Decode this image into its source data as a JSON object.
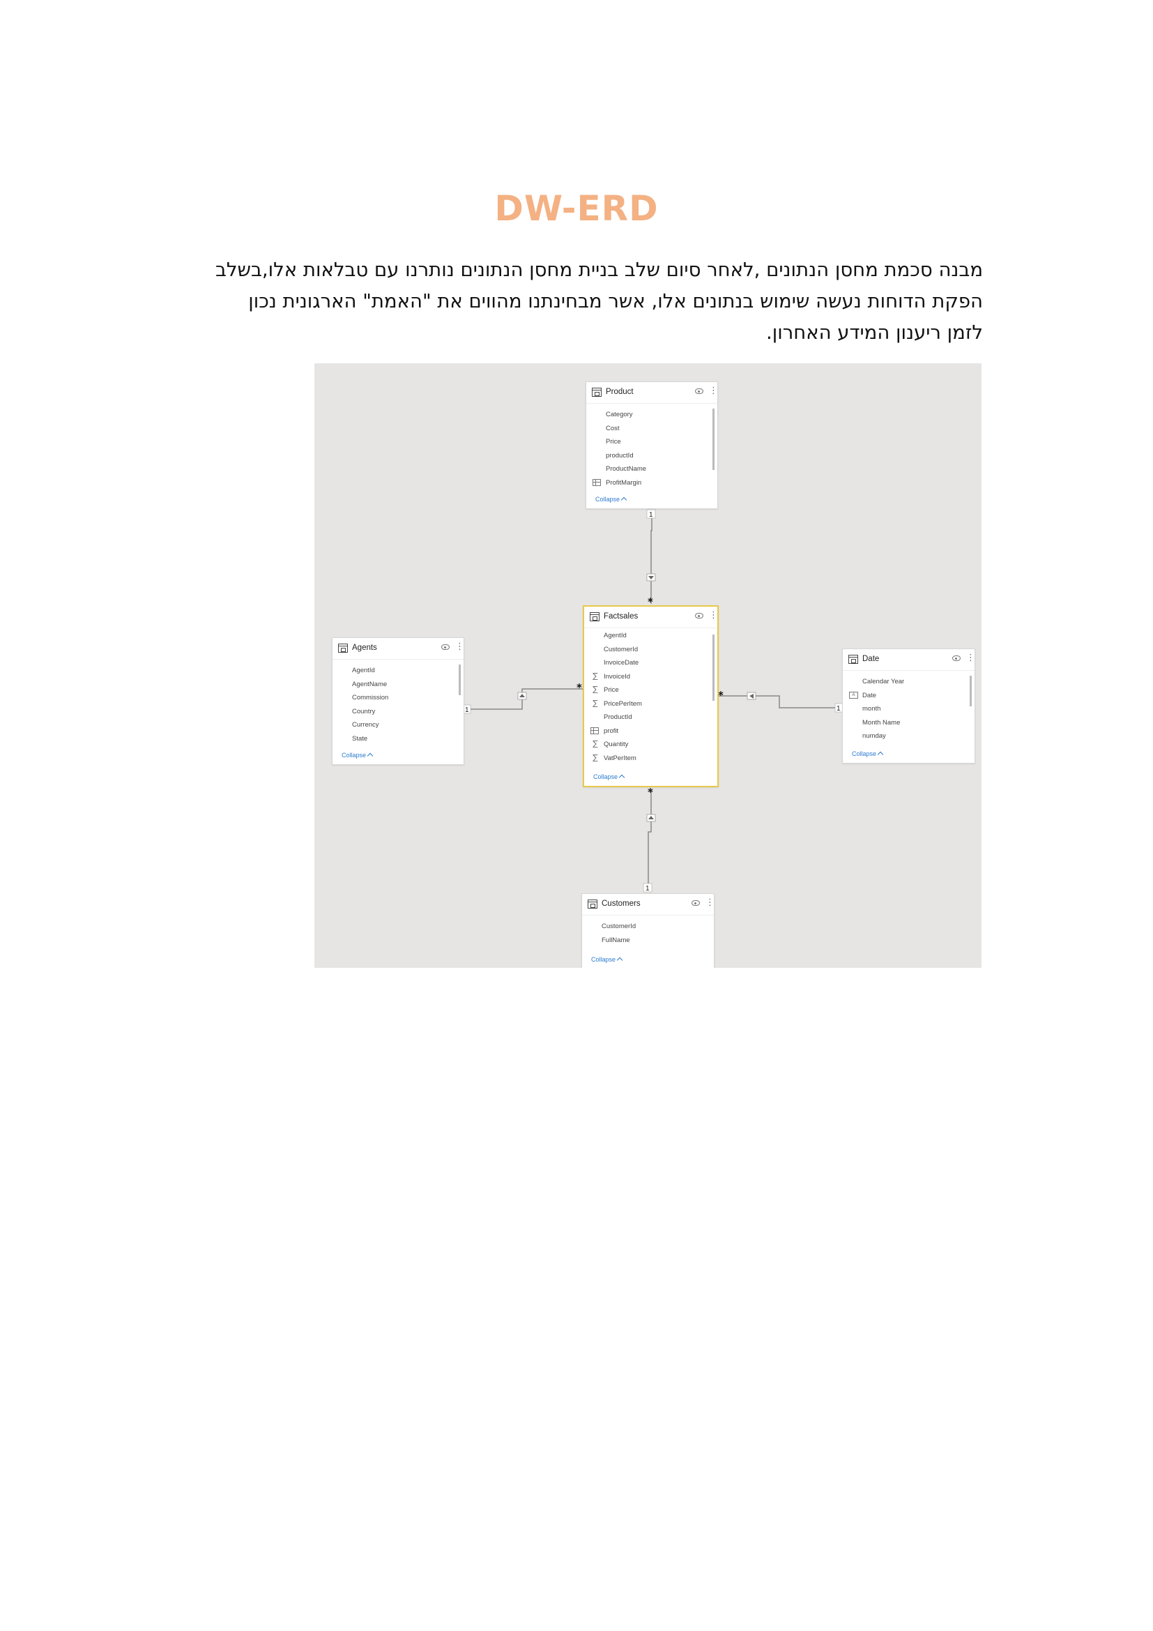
{
  "title": "DW-ERD",
  "paragraph_lines": [
    "מבנה סכמת מחסן הנתונים ,לאחר סיום שלב בניית מחסן הנתונים נותרנו עם טבלאות אלו,בשלב",
    "הפקת הדוחות נעשה שימוש בנתונים אלו, אשר מבחינתנו מהווים את \"האמת\" הארגונית נכון",
    "לזמן ריענון המידע האחרון."
  ],
  "diagram": {
    "tables": {
      "product": {
        "name": "Product",
        "fields": [
          {
            "label": "Category",
            "icon": "none"
          },
          {
            "label": "Cost",
            "icon": "none"
          },
          {
            "label": "Price",
            "icon": "none"
          },
          {
            "label": "productId",
            "icon": "none"
          },
          {
            "label": "ProductName",
            "icon": "none"
          },
          {
            "label": "ProfitMargin",
            "icon": "calculated-column-icon"
          }
        ],
        "collapse_label": "Collapse"
      },
      "factsales": {
        "name": "Factsales",
        "fields": [
          {
            "label": "AgentId",
            "icon": "none"
          },
          {
            "label": "CustomerId",
            "icon": "none"
          },
          {
            "label": "InvoiceDate",
            "icon": "none"
          },
          {
            "label": "InvoiceId",
            "icon": "sigma-icon"
          },
          {
            "label": "Price",
            "icon": "sigma-icon"
          },
          {
            "label": "PricePerItem",
            "icon": "sigma-icon"
          },
          {
            "label": "ProductId",
            "icon": "none"
          },
          {
            "label": "profit",
            "icon": "calculated-column-icon"
          },
          {
            "label": "Quantity",
            "icon": "sigma-icon"
          },
          {
            "label": "VatPerItem",
            "icon": "sigma-icon"
          }
        ],
        "collapse_label": "Collapse"
      },
      "agents": {
        "name": "Agents",
        "fields": [
          {
            "label": "AgentId",
            "icon": "none"
          },
          {
            "label": "AgentName",
            "icon": "none"
          },
          {
            "label": "Commission",
            "icon": "none"
          },
          {
            "label": "Country",
            "icon": "none"
          },
          {
            "label": "Currency",
            "icon": "none"
          },
          {
            "label": "State",
            "icon": "none"
          }
        ],
        "collapse_label": "Collapse"
      },
      "date": {
        "name": "Date",
        "fields": [
          {
            "label": "Calendar Year",
            "icon": "none"
          },
          {
            "label": "Date",
            "icon": "date-hierarchy-icon"
          },
          {
            "label": "month",
            "icon": "none"
          },
          {
            "label": "Month Name",
            "icon": "none"
          },
          {
            "label": "numday",
            "icon": "none"
          }
        ],
        "collapse_label": "Collapse"
      },
      "customers": {
        "name": "Customers",
        "fields": [
          {
            "label": "CustomerId",
            "icon": "none"
          },
          {
            "label": "FullName",
            "icon": "none"
          }
        ],
        "collapse_label": "Collapse"
      }
    },
    "relationships": [
      {
        "from": "Product",
        "to": "Factsales",
        "from_cardinality": "1",
        "to_cardinality": "*"
      },
      {
        "from": "Agents",
        "to": "Factsales",
        "from_cardinality": "1",
        "to_cardinality": "*"
      },
      {
        "from": "Date",
        "to": "Factsales",
        "from_cardinality": "1",
        "to_cardinality": "*"
      },
      {
        "from": "Customers",
        "to": "Factsales",
        "from_cardinality": "1",
        "to_cardinality": "*"
      }
    ],
    "colors": {
      "canvas": "#e6e5e3",
      "selected_border": "#e6c94a",
      "collapse_link": "#2b7bd0",
      "title": "#f4b183"
    }
  }
}
